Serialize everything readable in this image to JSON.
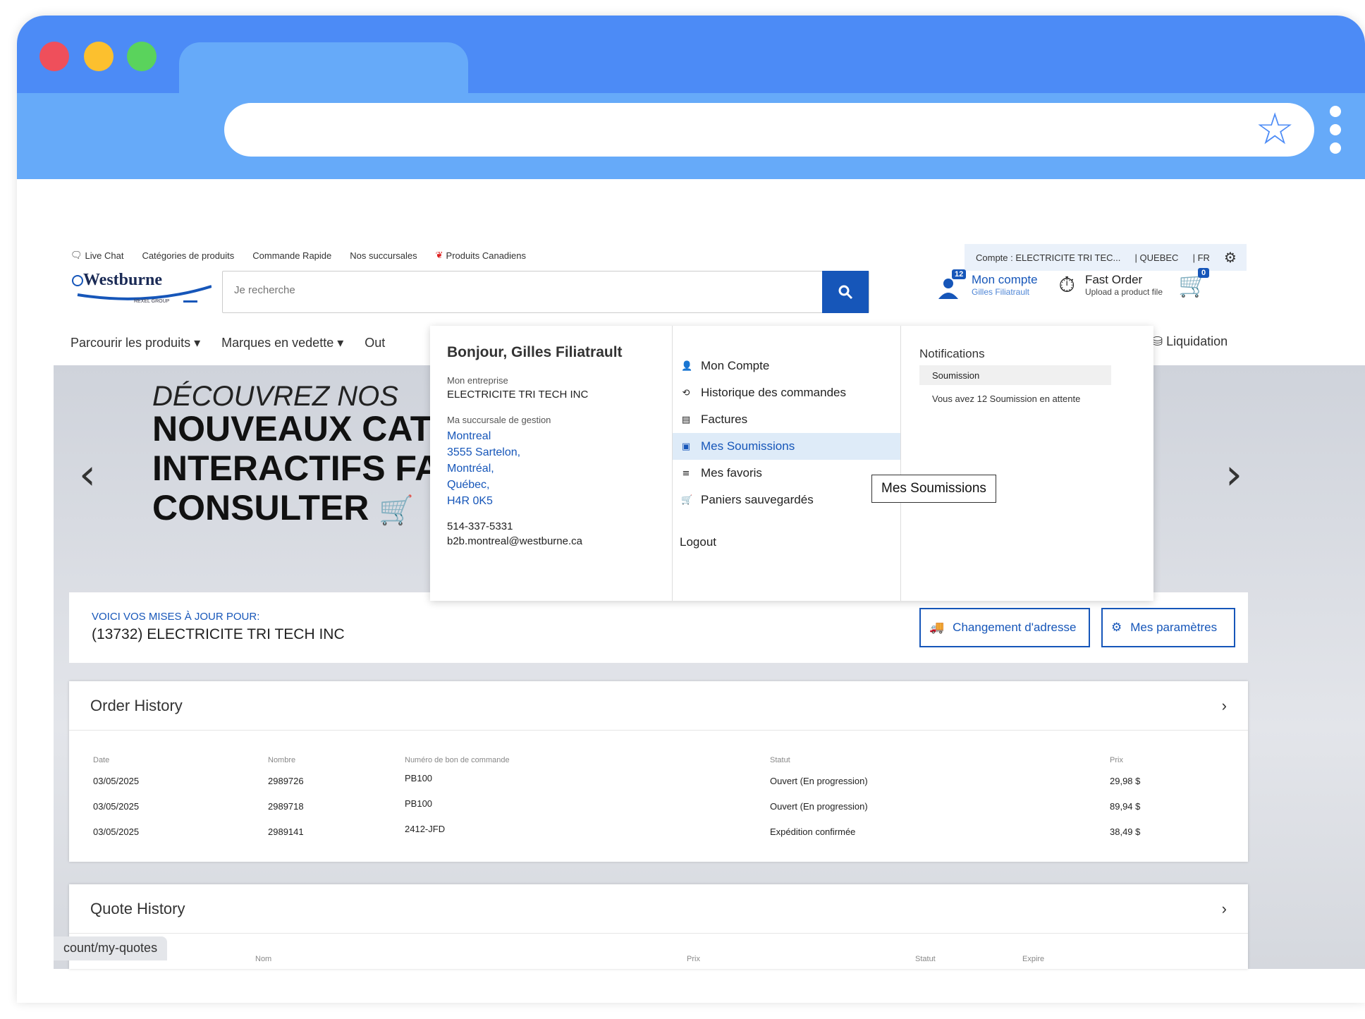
{
  "topbar": {
    "live_chat": "Live Chat",
    "categories": "Catégories de produits",
    "quick_order": "Commande Rapide",
    "branches": "Nos succursales",
    "canadian": "Produits Canadiens"
  },
  "account_bar": {
    "account": "Compte : ELECTRICITE TRI TEC...",
    "region": "| QUEBEC",
    "lang": "| FR"
  },
  "logo": {
    "name": "Westburne",
    "sub": "REXEL GROUP"
  },
  "search": {
    "placeholder": "Je recherche"
  },
  "account": {
    "badge": "12",
    "title": "Mon compte",
    "user": "Gilles Filiatrault"
  },
  "fast_order": {
    "title": "Fast Order",
    "sub": "Upload a product file"
  },
  "cart": {
    "badge": "0"
  },
  "nav": {
    "browse": "Parcourir les produits ▾",
    "brands": "Marques en vedette ▾",
    "out": "Out",
    "liquidation": "Liquidation"
  },
  "hero": {
    "line1": "DÉCOUVREZ NOS",
    "line2": "NOUVEAUX CAT",
    "line3": "INTERACTIFS FAC",
    "line4": "CONSULTER"
  },
  "dropdown": {
    "hello": "Bonjour, Gilles Filiatrault",
    "company_label": "Mon entreprise",
    "company": "ELECTRICITE TRI TECH INC",
    "branch_label": "Ma succursale de gestion",
    "branch_lines": [
      "Montreal",
      "3555 Sartelon,",
      "Montréal,",
      "Québec,",
      "H4R 0K5"
    ],
    "phone": "514-337-5331",
    "email": "b2b.montreal@westburne.ca",
    "menu": [
      {
        "label": "Mon Compte",
        "icon": "person-icon",
        "glyph": "👤"
      },
      {
        "label": "Historique des commandes",
        "icon": "history-icon",
        "glyph": "⟲"
      },
      {
        "label": "Factures",
        "icon": "invoice-icon",
        "glyph": "▤"
      },
      {
        "label": "Mes Soumissions",
        "icon": "quote-icon",
        "glyph": "▣"
      },
      {
        "label": "Mes favoris",
        "icon": "list-icon",
        "glyph": "≡"
      },
      {
        "label": "Paniers sauvegardés",
        "icon": "cart-icon",
        "glyph": "🛒"
      }
    ],
    "logout": "Logout",
    "notifications_title": "Notifications",
    "notif_item": "Soumission",
    "notif_text": "Vous avez 12 Soumission en attente"
  },
  "tooltip": "Mes Soumissions",
  "updates": {
    "label": "VOICI VOS MISES À JOUR POUR:",
    "account": "(13732) ELECTRICITE TRI TECH INC",
    "change_address": "Changement d'adresse",
    "settings": "Mes paramètres"
  },
  "order_history": {
    "title": "Order History",
    "headers": [
      "Date",
      "Nombre",
      "Numéro de bon de commande",
      "Statut",
      "Prix"
    ],
    "rows": [
      [
        "03/05/2025",
        "2989726",
        "PB100",
        "Ouvert (En progression)",
        "29,98 $"
      ],
      [
        "03/05/2025",
        "2989718",
        "PB100",
        "Ouvert (En progression)",
        "89,94 $"
      ],
      [
        "03/05/2025",
        "2989141",
        "2412-JFD",
        "Expédition confirmée",
        "38,49 $"
      ]
    ]
  },
  "quote_history": {
    "title": "Quote History",
    "headers": [
      "Nom",
      "Prix",
      "Statut",
      "Expire"
    ]
  },
  "statusbar": "count/my-quotes"
}
